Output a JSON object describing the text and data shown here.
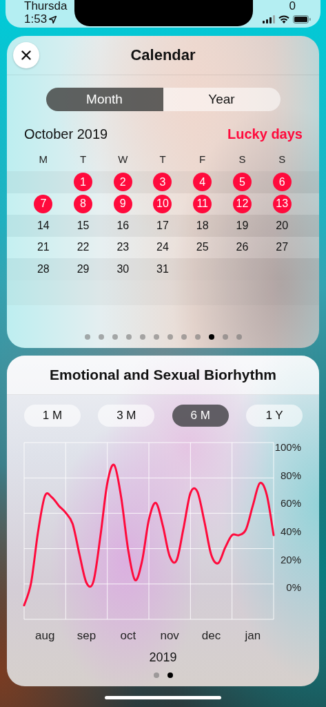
{
  "status_bar": {
    "day": "Thursda",
    "time": "1:53",
    "count": "0"
  },
  "calendar": {
    "title": "Calendar",
    "view_tabs": [
      {
        "label": "Month",
        "selected": true
      },
      {
        "label": "Year",
        "selected": false
      }
    ],
    "month": "October 2019",
    "lucky_days_label": "Lucky days",
    "weekdays": [
      "M",
      "T",
      "W",
      "T",
      "F",
      "S",
      "S"
    ],
    "weeks": [
      [
        {
          "day": "1",
          "lucky": true
        },
        {
          "day": "2",
          "lucky": true
        },
        {
          "day": "3",
          "lucky": true
        },
        {
          "day": "4",
          "lucky": true
        },
        {
          "day": "5",
          "lucky": true
        },
        {
          "day": "6",
          "lucky": true
        }
      ],
      [
        {
          "day": "7",
          "lucky": true
        },
        {
          "day": "8",
          "lucky": true
        },
        {
          "day": "9",
          "lucky": true
        },
        {
          "day": "10",
          "lucky": true
        },
        {
          "day": "11",
          "lucky": true
        },
        {
          "day": "12",
          "lucky": true
        },
        {
          "day": "13",
          "lucky": true
        }
      ],
      [
        {
          "day": "14",
          "lucky": false
        },
        {
          "day": "15",
          "lucky": false
        },
        {
          "day": "16",
          "lucky": false
        },
        {
          "day": "17",
          "lucky": false
        },
        {
          "day": "18",
          "lucky": false
        },
        {
          "day": "19",
          "lucky": false
        },
        {
          "day": "20",
          "lucky": false
        }
      ],
      [
        {
          "day": "21",
          "lucky": false
        },
        {
          "day": "22",
          "lucky": false
        },
        {
          "day": "23",
          "lucky": false
        },
        {
          "day": "24",
          "lucky": false
        },
        {
          "day": "25",
          "lucky": false
        },
        {
          "day": "26",
          "lucky": false
        },
        {
          "day": "27",
          "lucky": false
        }
      ],
      [
        {
          "day": "28",
          "lucky": false
        },
        {
          "day": "29",
          "lucky": false
        },
        {
          "day": "30",
          "lucky": false
        },
        {
          "day": "31",
          "lucky": false
        }
      ]
    ],
    "pages": [
      {
        "selected": false
      },
      {
        "selected": false
      },
      {
        "selected": false
      },
      {
        "selected": false
      },
      {
        "selected": false
      },
      {
        "selected": false
      },
      {
        "selected": false
      },
      {
        "selected": false
      },
      {
        "selected": false
      },
      {
        "selected": true
      },
      {
        "selected": false
      },
      {
        "selected": false
      }
    ]
  },
  "biorhythm": {
    "title": "Emotional and Sexual Biorhythm",
    "ranges": [
      {
        "label": "1 M",
        "selected": false
      },
      {
        "label": "3 M",
        "selected": false
      },
      {
        "label": "6 M",
        "selected": true
      },
      {
        "label": "1 Y",
        "selected": false
      }
    ],
    "chart_data": {
      "type": "line",
      "grid": true,
      "categories": [
        null,
        null,
        null,
        "aug",
        null,
        null,
        null,
        null,
        null,
        "sep",
        null,
        null,
        null,
        null,
        null,
        "oct",
        null,
        null,
        null,
        null,
        null,
        "nov",
        null,
        null,
        null,
        null,
        null,
        "dec",
        null,
        null,
        null,
        null,
        null,
        "jan",
        null,
        null,
        null
      ],
      "series": [
        {
          "color": "#ff0a3c",
          "values": [
            -13,
            3,
            39,
            65,
            64,
            58,
            53,
            45,
            23,
            3,
            4,
            36,
            74,
            87,
            64,
            27,
            5,
            18,
            48,
            60,
            44,
            22,
            19,
            42,
            67,
            68,
            47,
            23,
            17,
            28,
            37,
            37,
            41,
            58,
            74,
            66,
            37
          ]
        }
      ],
      "ylim": [
        -23,
        103
      ],
      "yticks": [
        {
          "value": 100,
          "label": "100%"
        },
        {
          "value": 80,
          "label": "80%"
        },
        {
          "value": 60,
          "label": "60%"
        },
        {
          "value": 40,
          "label": "40%"
        },
        {
          "value": 20,
          "label": "20%"
        },
        {
          "value": 0,
          "label": "0%"
        }
      ]
    },
    "year": "2019",
    "pages": [
      {
        "selected": false
      },
      {
        "selected": true
      }
    ]
  }
}
